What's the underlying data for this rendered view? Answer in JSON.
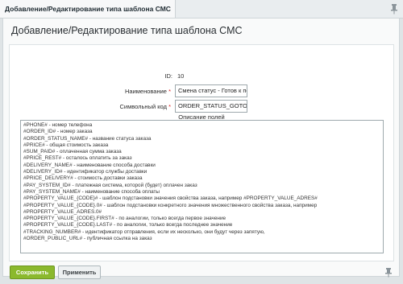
{
  "tab": {
    "title": "Добавление/Редактирование типа шаблона СМС"
  },
  "page": {
    "title": "Добавление/Редактирование типа шаблона СМС"
  },
  "form": {
    "id_label": "ID:",
    "id_value": "10",
    "name_label": "Наименование",
    "name_value": "Смена статус - Готов к по",
    "code_label": "Символьный код",
    "code_value": "ORDER_STATUS_GOTO",
    "required_mark": "*",
    "description_title": "Описание полей",
    "description_lines": [
      "#PHONE# - номер телефона",
      "#ORDER_ID# - номер заказа",
      "#ORDER_STATUS_NAME# - название статуса заказа",
      "#PRICE# - общая стоимость заказа",
      "#SUM_PAID# - оплаченная сумма заказа",
      "#PRICE_REST# - осталось оплатить за заказ",
      "#DELIVERY_NAME# - наименование способа доставки",
      "#DELIVERY_ID# - идентификатор службы доставки",
      "#PRICE_DELIVERY# - стоимость доставки заказа",
      "#PAY_SYSTEM_ID# - платежная система, которой (будет) оплачен заказ",
      "#PAY_SYSTEM_NAME# - наименование способа оплаты",
      "#PROPERTY_VALUE_{CODE}# - шаблон подстановки значения свойства заказа, например #PROPERTY_VALUE_ADRES#",
      "#PROPERTY_VALUE_{CODE}.0# - шаблон подстановки конкретного значения множественного свойства заказа, например",
      "#PROPERTY_VALUE_ADRES.0#",
      "#PROPERTY_VALUE_{CODE}.FIRST# - по аналогии, только всегда первое значение",
      "#PROPERTY_VALUE_{CODE}.LAST# - по аналогии, только всегда последнее значение",
      "#TRACKING_NUMBER# - идентификатор отправления, если их несколько, они будут через запятую,",
      "#ORDER_PUBLIC_URL# - публичная ссылка на заказ"
    ]
  },
  "footer": {
    "save_label": "Сохранить",
    "apply_label": "Применить"
  },
  "colors": {
    "accent": "#8bb92d",
    "background": "#dfe4e6",
    "required": "#dd2222"
  },
  "icons": {
    "top_right": "pin-icon",
    "bottom_right": "pin-icon"
  }
}
